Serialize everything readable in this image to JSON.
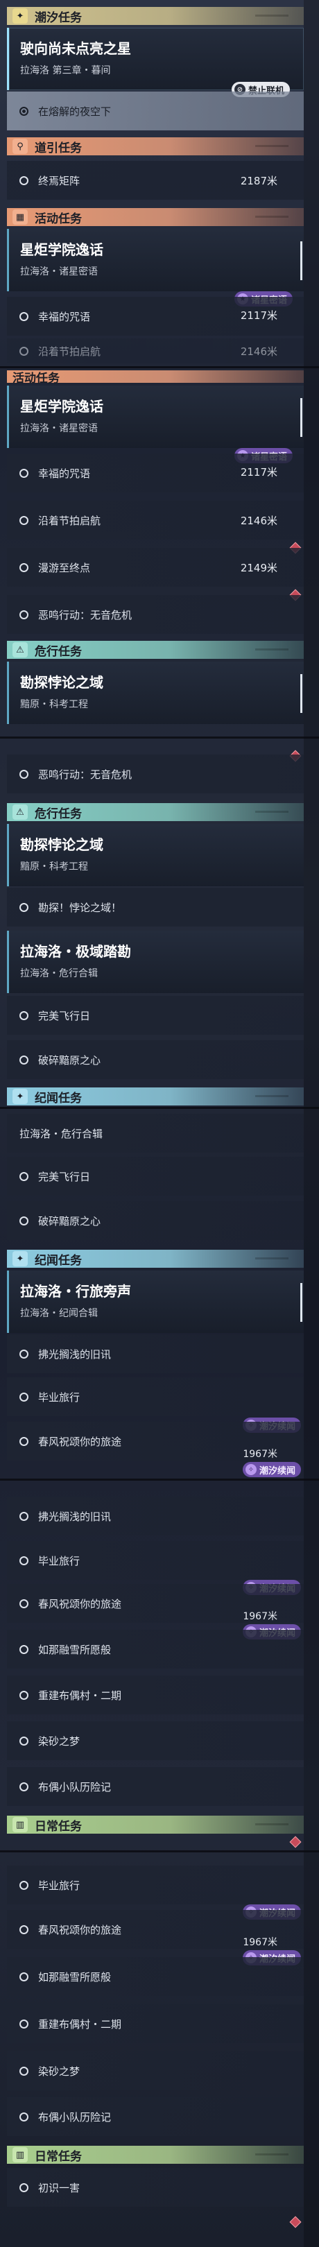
{
  "categories": {
    "tide": "潮汐任务",
    "guide": "道引任务",
    "event": "活动任务",
    "danger": "危行任务",
    "chronicle": "纪闻任务",
    "daily": "日常任务"
  },
  "quests": {
    "chase": {
      "title": "驶向尚未点亮之星",
      "sub": "拉海洛 第三章・暮间"
    },
    "academy": {
      "title": "星炬学院逸话",
      "sub": "拉海洛・诸星密语"
    },
    "explore": {
      "title": "勘探悖论之域",
      "sub": "黯原・科考工程"
    },
    "extreme": {
      "title": "拉海洛・极域踏勘",
      "sub": "拉海洛・危行合辑"
    },
    "travel": {
      "title": "拉海洛・行旅旁声",
      "sub": "拉海洛・纪闻合辑"
    }
  },
  "steps": {
    "night": "在熔解的夜空下",
    "final_array": "终焉矩阵",
    "curse": "幸福的咒语",
    "tide_sail": "沿着节拍启航",
    "drift": "漫游至终点",
    "evil": "恶鸣行动：无音危机",
    "explore_go": "勘探！悖论之域！",
    "fly": "完美飞行日",
    "broken": "破碎黯原之心",
    "old_news": "拂光搁浅的旧讯",
    "graduation": "毕业旅行",
    "spring": "春风祝颂你的旅途",
    "snow": "如那融雪所愿般",
    "doll": "重建布偶村・二期",
    "dream": "染砂之梦",
    "cloth": "布偶小队历险记",
    "first": "初识一害",
    "cut": "沿着节拍启航"
  },
  "distances": {
    "final_array": "2187米",
    "curse": "2117米",
    "tide_sail": "2146米",
    "drift": "2149米",
    "spring": "1967米",
    "cut": "2146米"
  },
  "tags": {
    "no_coop": "禁止联机",
    "stars": "诸星密语",
    "tide_sequel": "潮汐续闻"
  },
  "icons": {
    "tide": "sparkle-icon",
    "guide": "location-pin-icon",
    "event": "calendar-icon",
    "danger": "danger-icon",
    "chronicle": "sparkle-icon",
    "daily": "book-icon"
  }
}
